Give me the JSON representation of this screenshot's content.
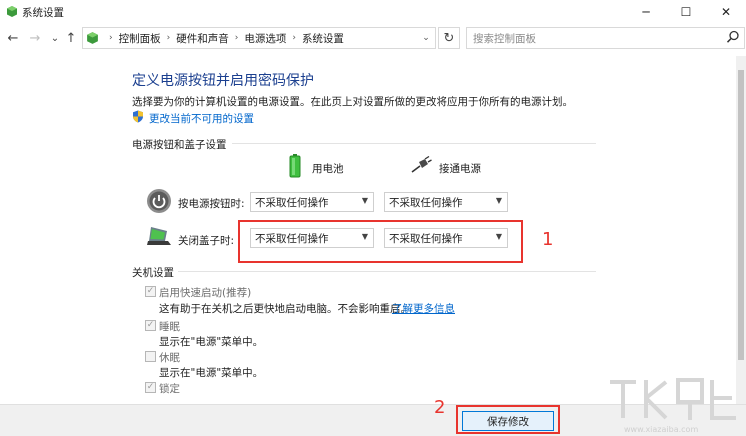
{
  "window": {
    "title": "系统设置",
    "minimize": "─",
    "maximize": "☐",
    "close": "✕"
  },
  "nav": {
    "back": "←",
    "forward": "→",
    "dropdown": "⌄",
    "up": "↑",
    "breadcrumb": [
      "控制面板",
      "硬件和声音",
      "电源选项",
      "系统设置"
    ],
    "breadcrumb_sep": "›",
    "refresh": "↻",
    "search_placeholder": "搜索控制面板"
  },
  "page": {
    "heading": "定义电源按钮并启用密码保护",
    "description": "选择要为你的计算机设置的电源设置。在此页上对设置所做的更改将应用于你所有的电源计划。",
    "change_link": "更改当前不可用的设置"
  },
  "power_section": {
    "title": "电源按钮和盖子设置",
    "col_battery": "用电池",
    "col_plugged": "接通电源",
    "rows": [
      {
        "label": "按电源按钮时:",
        "battery": "不采取任何操作",
        "plugged": "不采取任何操作"
      },
      {
        "label": "关闭盖子时:",
        "battery": "不采取任何操作",
        "plugged": "不采取任何操作"
      }
    ]
  },
  "shutdown_section": {
    "title": "关机设置",
    "items": [
      {
        "label": "启用快速启动(推荐)",
        "checked": true,
        "desc": "这有助于在关机之后更快地启动电脑。不会影响重启。",
        "link": "了解更多信息"
      },
      {
        "label": "睡眠",
        "checked": true,
        "desc": "显示在\"电源\"菜单中。"
      },
      {
        "label": "休眠",
        "checked": false,
        "desc": "显示在\"电源\"菜单中。"
      },
      {
        "label": "锁定",
        "checked": true
      }
    ]
  },
  "annotations": {
    "label1": "1",
    "label2": "2"
  },
  "footer": {
    "save_label": "保存修改"
  },
  "colors": {
    "accent": "#1b3f8f",
    "link": "#0066cc",
    "annotation": "#e8342e"
  }
}
